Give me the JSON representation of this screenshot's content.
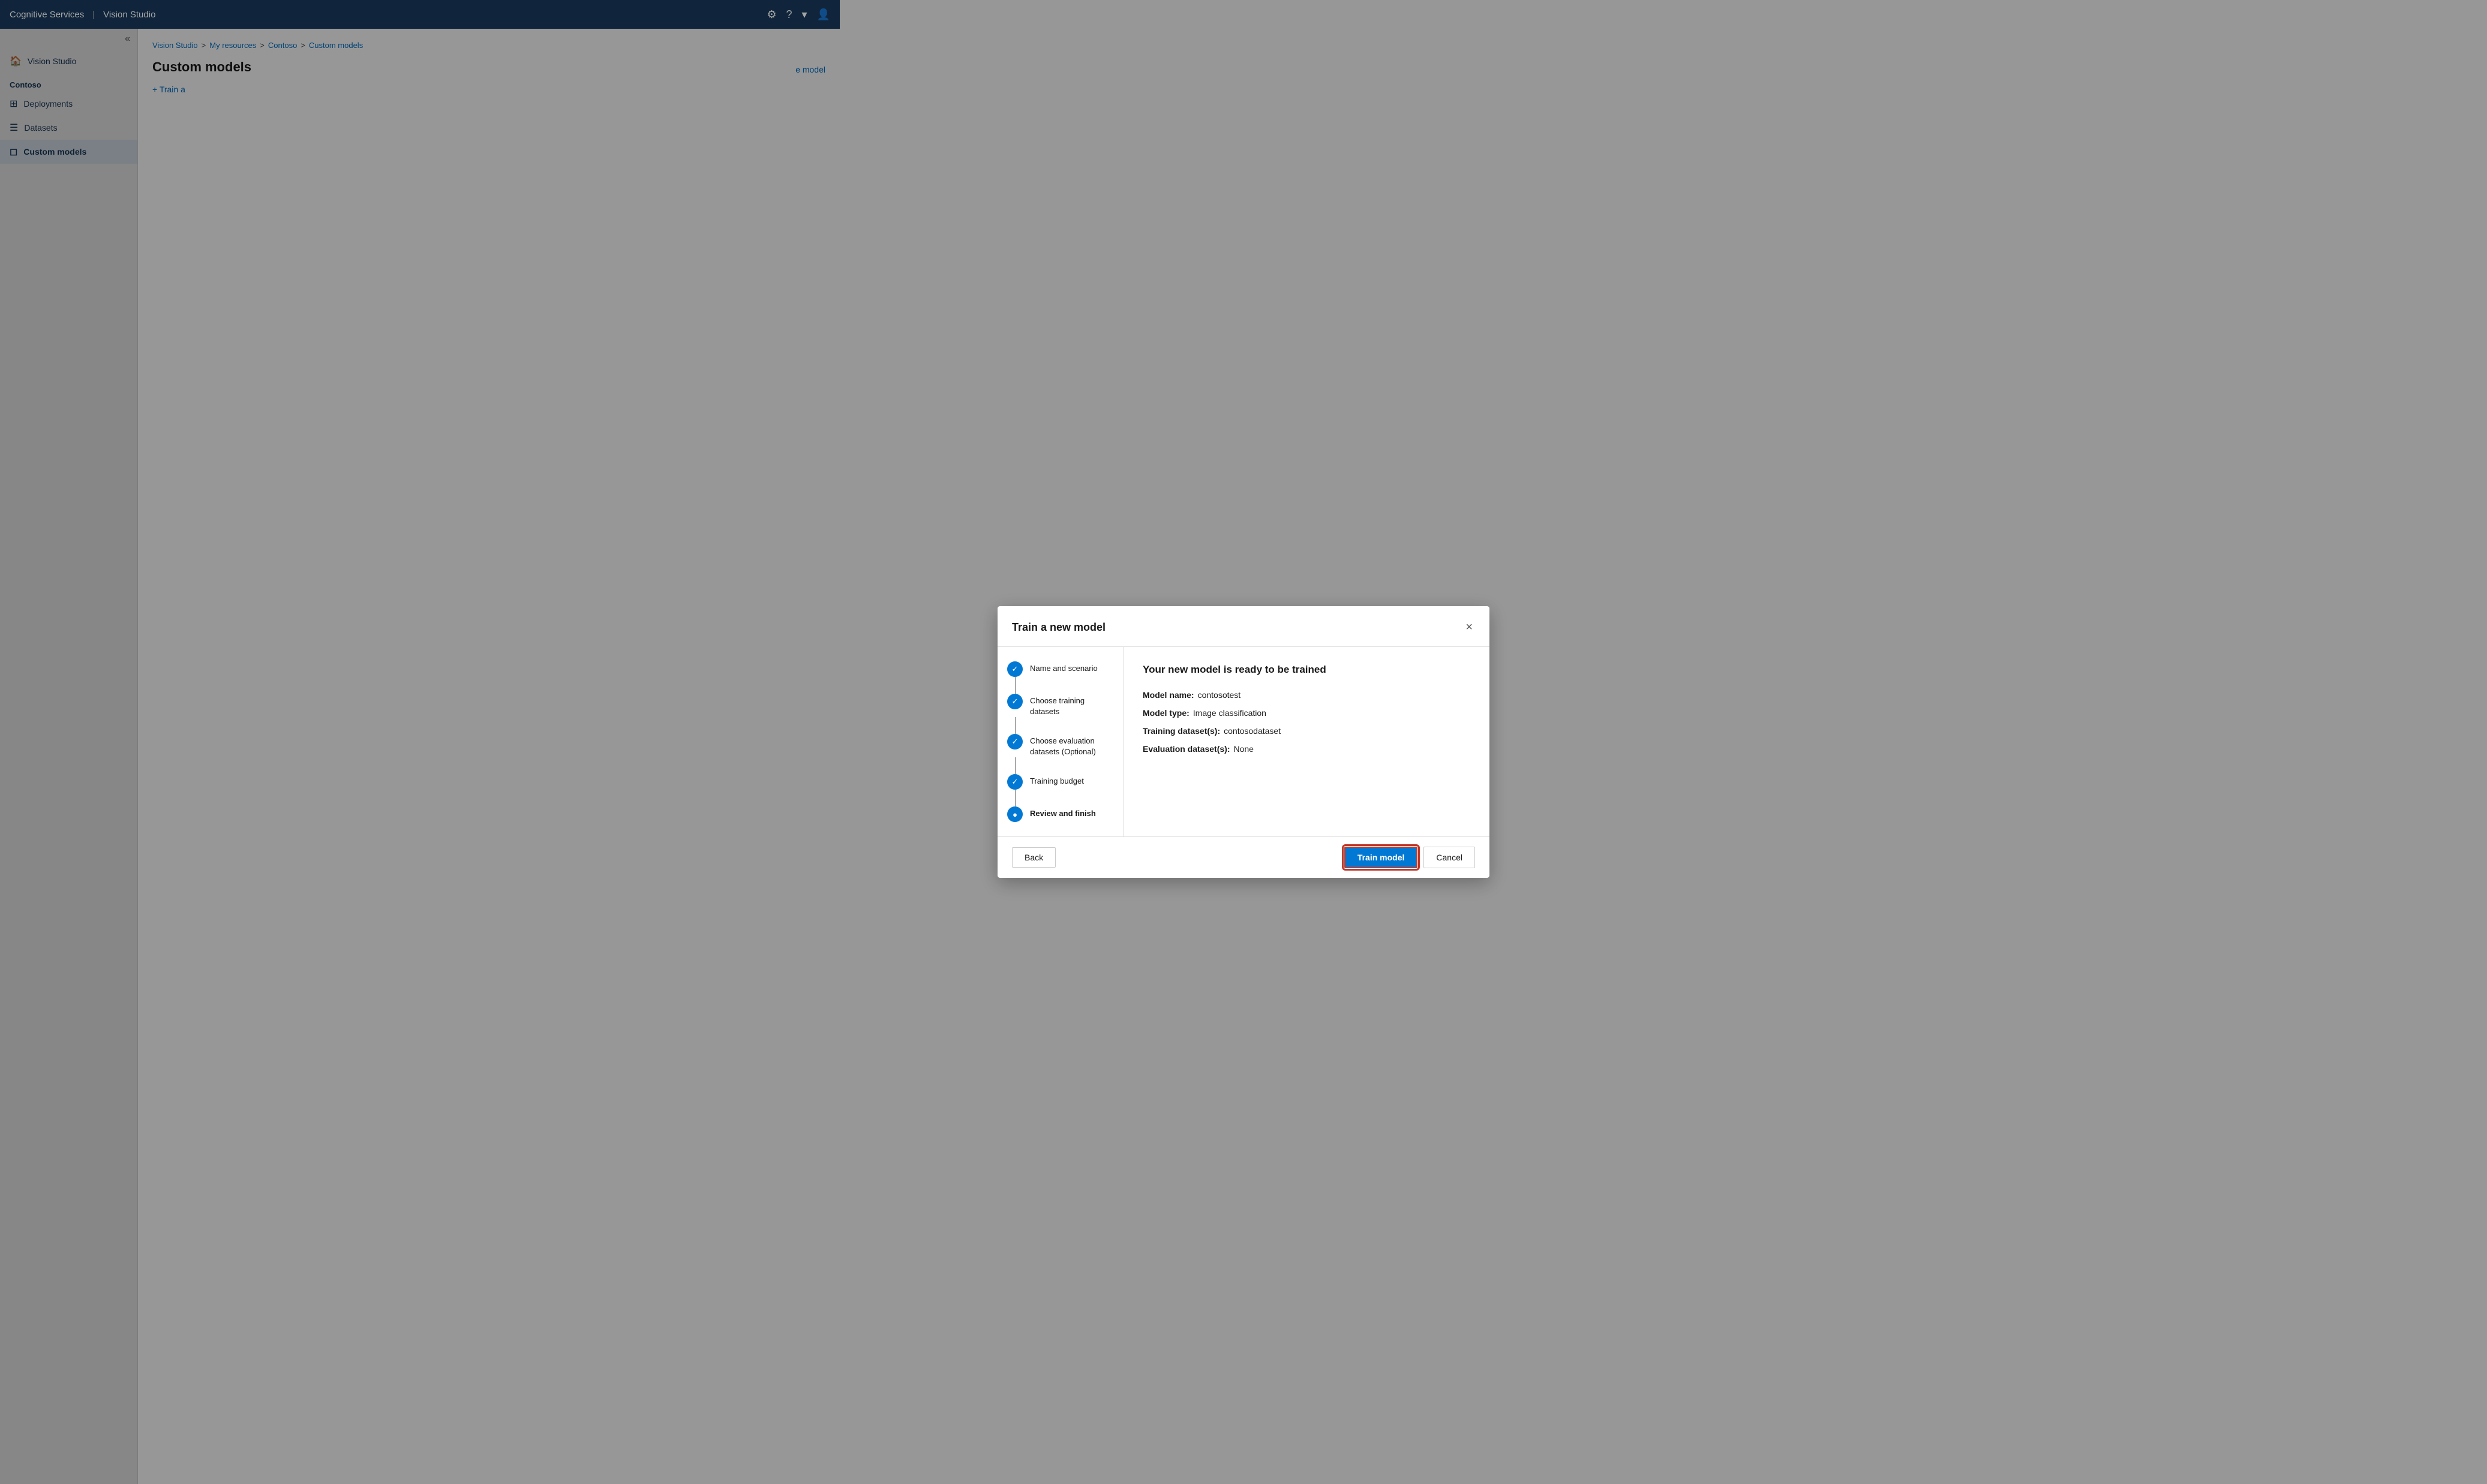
{
  "app": {
    "name": "Cognitive Services",
    "separator": "|",
    "subtitle": "Vision Studio"
  },
  "topbar": {
    "icons": {
      "settings": "⚙",
      "help": "?",
      "chevron": "▾",
      "account": "👤"
    }
  },
  "sidebar": {
    "collapse_icon": "«",
    "items": [
      {
        "id": "vision-studio",
        "label": "Vision Studio",
        "icon": "🏠",
        "active": false
      },
      {
        "id": "contoso",
        "label": "Contoso",
        "is_section": true
      },
      {
        "id": "deployments",
        "label": "Deployments",
        "icon": "⊞",
        "active": false
      },
      {
        "id": "datasets",
        "label": "Datasets",
        "icon": "☰",
        "active": false
      },
      {
        "id": "custom-models",
        "label": "Custom models",
        "icon": "◻",
        "active": true
      }
    ]
  },
  "breadcrumb": {
    "items": [
      "Vision Studio",
      "My resources",
      "Contoso",
      "Custom models"
    ],
    "separator": ">"
  },
  "page": {
    "title": "Custom models",
    "train_new_label": "+ Train a"
  },
  "right_action": {
    "label": "e model"
  },
  "modal": {
    "title": "Train a new model",
    "close_label": "×",
    "steps": [
      {
        "id": "name-scenario",
        "label": "Name and scenario",
        "state": "completed"
      },
      {
        "id": "training-datasets",
        "label": "Choose training datasets",
        "state": "completed"
      },
      {
        "id": "evaluation-datasets",
        "label": "Choose evaluation datasets (Optional)",
        "state": "completed"
      },
      {
        "id": "training-budget",
        "label": "Training budget",
        "state": "completed"
      },
      {
        "id": "review-finish",
        "label": "Review and finish",
        "state": "active"
      }
    ],
    "review": {
      "title": "Your new model is ready to be trained",
      "fields": [
        {
          "label": "Model name:",
          "value": "contosotest"
        },
        {
          "label": "Model type:",
          "value": "Image classification"
        },
        {
          "label": "Training dataset(s):",
          "value": "contosodataset"
        },
        {
          "label": "Evaluation dataset(s):",
          "value": "None"
        }
      ]
    },
    "footer": {
      "back_label": "Back",
      "train_label": "Train model",
      "cancel_label": "Cancel"
    }
  }
}
